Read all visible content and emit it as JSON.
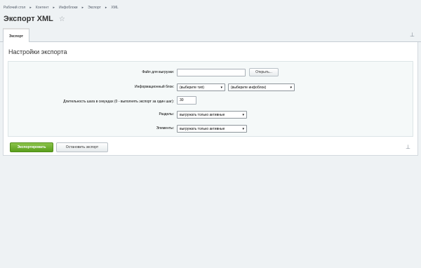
{
  "breadcrumb": [
    "Рабочий стол",
    "Контент",
    "Инфоблоки",
    "Экспорт",
    "XML"
  ],
  "breadcrumb_separator": "▸",
  "page_title": "Экспорт XML",
  "tab_label": "Экспорт",
  "section_title": "Настройки экспорта",
  "form": {
    "file_label": "Файл для выгрузки:",
    "file_value": "",
    "open_button": "Открыть...",
    "iblock_label": "Информационный блок:",
    "type_select": "(выберите тип)",
    "iblock_select": "(выберите инфоблок)",
    "step_label": "Длительность шага в секундах (0 - выполнять экспорт за один шаг):",
    "step_value": "30",
    "sections_label": "Разделы:",
    "sections_select": "выгружать только активные",
    "elements_label": "Элементы:",
    "elements_select": "выгружать только активные"
  },
  "buttons": {
    "export": "Экспортировать",
    "stop": "Остановить экспорт"
  },
  "icons": {
    "star": "star-icon",
    "pin": "pin-icon",
    "chevron": "chevron-down-icon"
  },
  "colors": {
    "accent_green": "#5a9e1c",
    "page_background": "#eef2f4"
  }
}
